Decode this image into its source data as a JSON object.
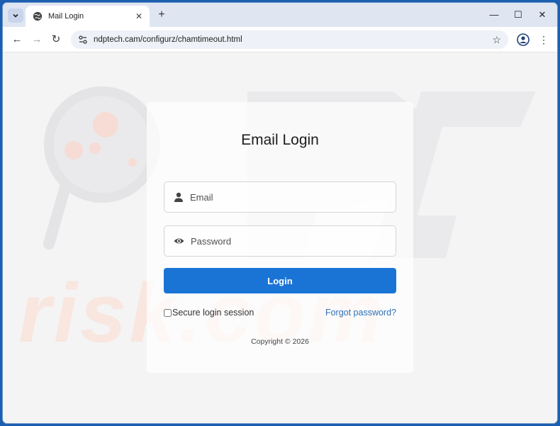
{
  "browser": {
    "tab": {
      "title": "Mail Login",
      "close_glyph": "✕"
    },
    "new_tab_glyph": "+",
    "window_controls": {
      "minimize": "—",
      "maximize": "☐",
      "close": "✕"
    },
    "nav": {
      "back": "←",
      "forward": "→",
      "reload": "↻"
    },
    "address": {
      "url": "ndptech.cam/configurz/chamtimeout.html"
    },
    "bookmark_glyph": "☆",
    "menu_glyph": "⋮"
  },
  "login": {
    "title": "Email Login",
    "email_placeholder": "Email",
    "password_placeholder": "Password",
    "login_button": "Login",
    "remember_label": "Secure login session",
    "forgot_link": "Forgot password?",
    "copyright": "Copyright © 2026"
  },
  "watermark": {
    "text": "risk.com",
    "logo_text": "PC"
  },
  "colors": {
    "login_button": "#1a74d6",
    "link": "#2d6fb7",
    "frame": "#1c5fb0"
  }
}
